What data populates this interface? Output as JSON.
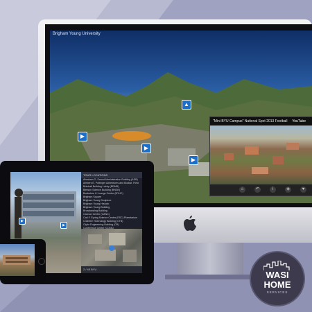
{
  "imac": {
    "brand_label": "Brigham Young University",
    "video": {
      "title": "\"Mini BYU Campus\" National Spot 2013 Football",
      "provider": "YouTube",
      "controls": [
        "home",
        "back",
        "info",
        "map",
        "heart"
      ]
    }
  },
  "tablet": {
    "list_heading": "TOUR LOCATIONS",
    "locations": [
      "Abraham O. Smoot Administration Building (ASB)",
      "Ambers E. Pottinger Adventures and Bookst. Field",
      "Brimhall Building Lobby (BRMB)",
      "Benson Science Building (BNSN)",
      "Bookstore & Lounge Center (BYUC)",
      "Brigham Square",
      "Brigham Young Sculpture",
      "Brigham Young Historic",
      "Brigham Young Building",
      "Broadcasting Building",
      "Cannon Center (CANC)",
      "Carl F. Eyring Science Center (ESC) Planetarium",
      "Crabtree Technology Building (CTB)",
      "Clyde Engineering Building (CB)",
      "Conference Center (CONC)",
      "David M. Kennedy Center for International Studies",
      "Ernest L. Wilkinson Student Center",
      "Eyring Science Center (ESC)"
    ],
    "footer_label": "2 / 45 BYU"
  },
  "logo": {
    "line1": "WASI",
    "line2": "HOME",
    "line3": "SERVICES"
  }
}
